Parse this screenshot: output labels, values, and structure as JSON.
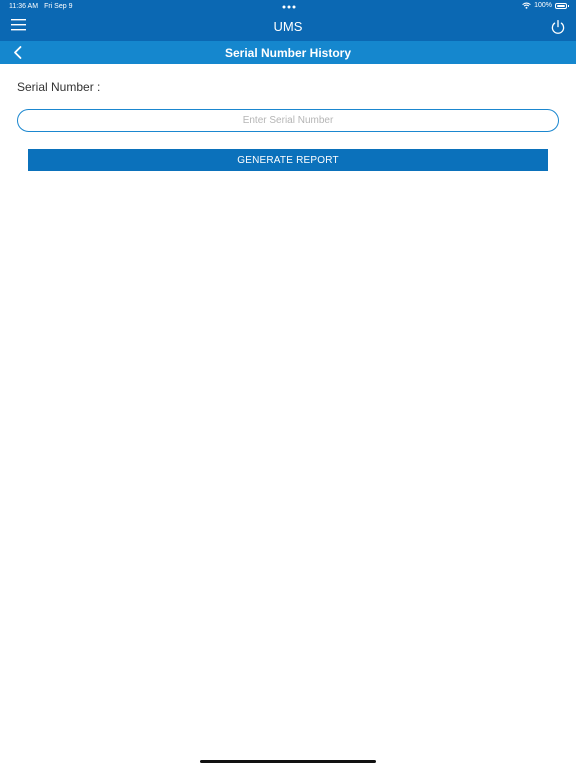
{
  "status_bar": {
    "time": "11:36 AM",
    "date": "Fri Sep 9",
    "battery": "100%",
    "wifi_icon": "wifi-icon",
    "battery_icon": "battery-icon",
    "battery_level": 1.0
  },
  "header": {
    "title": "UMS",
    "menu_icon": "menu-icon",
    "power_icon": "power-icon"
  },
  "nav": {
    "title": "Serial Number History",
    "back_icon": "chevron-left-icon"
  },
  "form": {
    "serial_label": "Serial Number :",
    "serial_value": "",
    "serial_placeholder": "Enter Serial Number",
    "generate_label": "GENERATE REPORT"
  },
  "colors": {
    "header_bg": "#0b68b3",
    "nav_bg": "#1587ce",
    "button_bg": "#0b71bb",
    "input_border": "#1b87cf"
  }
}
